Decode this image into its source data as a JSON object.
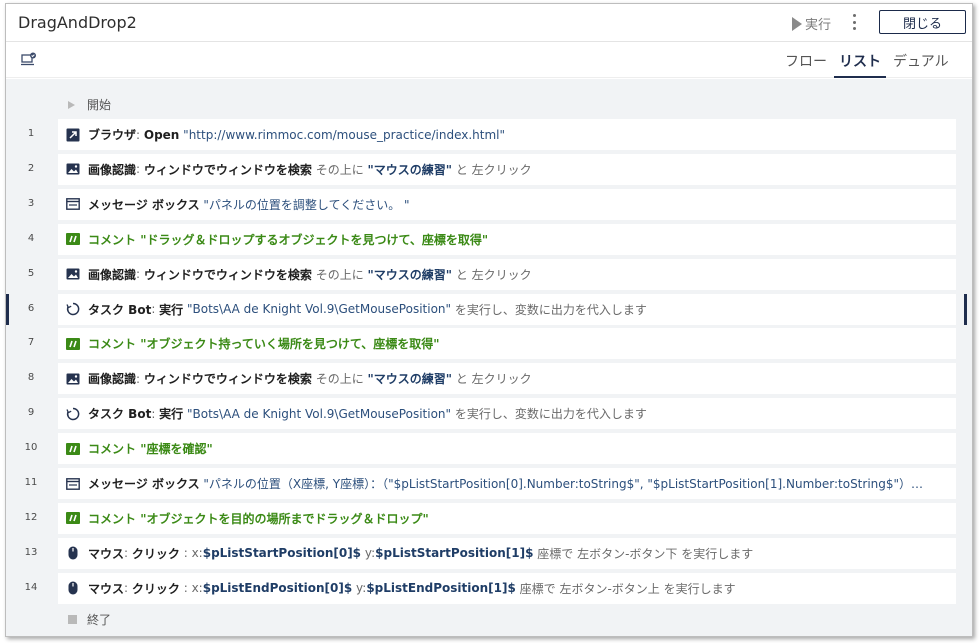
{
  "title": "DragAndDrop2",
  "header": {
    "run_label": "実行",
    "close_label": "閉じる"
  },
  "tabs": [
    {
      "label": "フロー",
      "active": false
    },
    {
      "label": "リスト",
      "active": true
    },
    {
      "label": "デュアル",
      "active": false
    }
  ],
  "start_label": "開始",
  "end_label": "終了",
  "rows": [
    {
      "num": "1",
      "icon": "browser-open-icon",
      "parts": [
        {
          "t": "ブラウザ",
          "c": "kw"
        },
        {
          "t": ": ",
          "c": "g"
        },
        {
          "t": "Open",
          "c": "kw"
        },
        {
          "t": " \"http://www.rimmoc.com/mouse_practice/index.html\"",
          "c": "q"
        }
      ]
    },
    {
      "num": "2",
      "icon": "image-recognition-icon",
      "parts": [
        {
          "t": "画像認識",
          "c": "kw"
        },
        {
          "t": ": ",
          "c": "g"
        },
        {
          "t": "ウィンドウでウィンドウを検索",
          "c": "kw"
        },
        {
          "t": " その上に ",
          "c": "g"
        },
        {
          "t": "\"マウスの練習\"",
          "c": "q-b"
        },
        {
          "t": " と 左クリック",
          "c": "g"
        }
      ]
    },
    {
      "num": "3",
      "icon": "message-box-icon",
      "parts": [
        {
          "t": "メッセージ ボックス",
          "c": "kw"
        },
        {
          "t": " \"パネルの位置を調整してください。 \"",
          "c": "q"
        }
      ]
    },
    {
      "num": "4",
      "icon": "comment-icon",
      "parts": [
        {
          "t": "コメント",
          "c": "cmt"
        },
        {
          "t": " \"ドラッグ＆ドロップするオブジェクトを見つけて、座標を取得\"",
          "c": "cmt"
        }
      ]
    },
    {
      "num": "5",
      "icon": "image-recognition-icon",
      "parts": [
        {
          "t": "画像認識",
          "c": "kw"
        },
        {
          "t": ": ",
          "c": "g"
        },
        {
          "t": "ウィンドウでウィンドウを検索",
          "c": "kw"
        },
        {
          "t": " その上に ",
          "c": "g"
        },
        {
          "t": "\"マウスの練習\"",
          "c": "q-b"
        },
        {
          "t": " と 左クリック",
          "c": "g"
        }
      ]
    },
    {
      "num": "6",
      "icon": "task-bot-icon",
      "selected": true,
      "parts": [
        {
          "t": "タスク Bot",
          "c": "kw"
        },
        {
          "t": ": ",
          "c": "g"
        },
        {
          "t": "実行",
          "c": "kw"
        },
        {
          "t": " \"Bots\\AA de Knight Vol.9\\GetMousePosition\"",
          "c": "q"
        },
        {
          "t": " を実行し、変数に出力を代入します",
          "c": "g"
        }
      ]
    },
    {
      "num": "7",
      "icon": "comment-icon",
      "parts": [
        {
          "t": "コメント",
          "c": "cmt"
        },
        {
          "t": " \"オブジェクト持っていく場所を見つけて、座標を取得\"",
          "c": "cmt"
        }
      ]
    },
    {
      "num": "8",
      "icon": "image-recognition-icon",
      "parts": [
        {
          "t": "画像認識",
          "c": "kw"
        },
        {
          "t": ": ",
          "c": "g"
        },
        {
          "t": "ウィンドウでウィンドウを検索",
          "c": "kw"
        },
        {
          "t": " その上に ",
          "c": "g"
        },
        {
          "t": "\"マウスの練習\"",
          "c": "q-b"
        },
        {
          "t": " と 左クリック",
          "c": "g"
        }
      ]
    },
    {
      "num": "9",
      "icon": "task-bot-icon",
      "parts": [
        {
          "t": "タスク Bot",
          "c": "kw"
        },
        {
          "t": ": ",
          "c": "g"
        },
        {
          "t": "実行",
          "c": "kw"
        },
        {
          "t": " \"Bots\\AA de Knight Vol.9\\GetMousePosition\"",
          "c": "q"
        },
        {
          "t": " を実行し、変数に出力を代入します",
          "c": "g"
        }
      ]
    },
    {
      "num": "10",
      "icon": "comment-icon",
      "parts": [
        {
          "t": "コメント",
          "c": "cmt"
        },
        {
          "t": " \"座標を確認\"",
          "c": "cmt"
        }
      ]
    },
    {
      "num": "11",
      "icon": "message-box-icon",
      "parts": [
        {
          "t": "メッセージ ボックス",
          "c": "kw"
        },
        {
          "t": " \"パネルの位置（X座標, Y座標）：（\"$pListStartPosition[0].Number:toString$\", \"$pListStartPosition[1].Number:toString$\"）…",
          "c": "q"
        }
      ]
    },
    {
      "num": "12",
      "icon": "comment-icon",
      "parts": [
        {
          "t": "コメント",
          "c": "cmt"
        },
        {
          "t": " \"オブジェクトを目的の場所までドラッグ＆ドロップ\"",
          "c": "cmt"
        }
      ]
    },
    {
      "num": "13",
      "icon": "mouse-icon",
      "parts": [
        {
          "t": "マウス",
          "c": "kw"
        },
        {
          "t": ": ",
          "c": "g"
        },
        {
          "t": "クリック",
          "c": "kw"
        },
        {
          "t": " : x:",
          "c": "g"
        },
        {
          "t": "$pListStartPosition[0]$",
          "c": "var"
        },
        {
          "t": " y:",
          "c": "g"
        },
        {
          "t": "$pListStartPosition[1]$",
          "c": "var"
        },
        {
          "t": " 座標で 左ボタン-ボタン下 を実行します",
          "c": "g"
        }
      ]
    },
    {
      "num": "14",
      "icon": "mouse-icon",
      "parts": [
        {
          "t": "マウス",
          "c": "kw"
        },
        {
          "t": ": ",
          "c": "g"
        },
        {
          "t": "クリック",
          "c": "kw"
        },
        {
          "t": " : x:",
          "c": "g"
        },
        {
          "t": "$pListEndPosition[0]$",
          "c": "var"
        },
        {
          "t": " y:",
          "c": "g"
        },
        {
          "t": "$pListEndPosition[1]$",
          "c": "var"
        },
        {
          "t": " 座標で 左ボタン-ボタン上 を実行します",
          "c": "g"
        }
      ]
    }
  ],
  "colors": {
    "accent": "#1f2d4d",
    "comment": "#3b8a16",
    "list_bg": "#f1f3f5"
  }
}
